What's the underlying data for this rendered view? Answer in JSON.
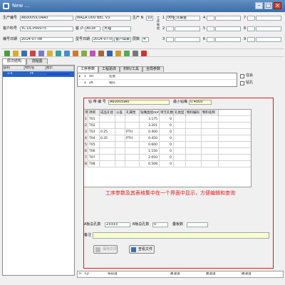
{
  "window": {
    "title": "New ..."
  },
  "header": {
    "prod_no_label": "生产编号",
    "prod_no": "A60005IC04A0",
    "machine": "MAZA D00 BEC V3",
    "prod_qty_label": "生产 N",
    "prod_qty": "10",
    "cust_no_label": "客户料号",
    "cust_no": "YC.DL.P00075",
    "cust_label": "客  户",
    "cust_code": "A018",
    "cust_name": "大福",
    "date_label": "编号日期",
    "date": "2014-07-08",
    "type_date_label": "型号日期",
    "type_date": "2014-07-07",
    "type_date_extra": "客户由来",
    "layers_label": "层数",
    "layers": "4",
    "side_label": "工序制程",
    "right_codes": [
      {
        "code": "1",
        "val": "000",
        "name": "沉镍金"
      },
      {
        "code": "2",
        "val": "",
        "name": ""
      },
      {
        "code": "3",
        "val": "",
        "name": ""
      },
      {
        "code": "4",
        "val": "",
        "name": ""
      },
      {
        "code": "5",
        "val": "",
        "name": ""
      },
      {
        "code": "6",
        "val": "",
        "name": ""
      },
      {
        "code": "7",
        "val": "",
        "name": ""
      },
      {
        "code": "8",
        "val": "",
        "name": ""
      },
      {
        "code": "9",
        "val": "",
        "name": ""
      }
    ]
  },
  "left_tabs": [
    "层次结构",
    "流程图"
  ],
  "left_table": {
    "headers": [
      "层码",
      "材料名",
      "图示"
    ],
    "rows": [
      {
        "code": "1-4",
        "material": "PP"
      }
    ]
  },
  "main_tabs": [
    "工序参数",
    "工程更改",
    "材料/工具",
    "全局参数"
  ],
  "steps": [
    {
      "mark": "▸",
      "num": "1",
      "code": "VH",
      "name": "任会"
    },
    {
      "mark": "",
      "num": "2",
      "code": "ZK",
      "name": "钻孔"
    }
  ],
  "steps_side_labels": [
    "任会",
    "钻孔"
  ],
  "form": {
    "drill_no_label": "钻 带 编 号",
    "drill_no": "A60005IA0",
    "min_drill_label": "最小钻嘴",
    "min_drill": "0.4000"
  },
  "grid": {
    "headers": [
      "序",
      "项目",
      "成品孔径",
      "公差",
      "孔属性",
      "钻嘴直径mm",
      "单元孔数",
      "孔类型",
      "物料编码",
      "物料名称"
    ],
    "rows": [
      [
        "1",
        "T01",
        "",
        "",
        "",
        "3.175",
        "0",
        "",
        "",
        ""
      ],
      [
        "2",
        "T02",
        "",
        "",
        "",
        "3.201",
        "0",
        "",
        "",
        ""
      ],
      [
        "3",
        "T03",
        "0.25",
        "",
        "PTH",
        "0.400",
        "0",
        "",
        "",
        ""
      ],
      [
        "4",
        "T04",
        "0.35",
        "",
        "PTH",
        "0.450",
        "0",
        "",
        "",
        ""
      ],
      [
        "5",
        "T05",
        "",
        "",
        "",
        "0.600",
        "0",
        "",
        "",
        ""
      ],
      [
        "6",
        "T06",
        "",
        "",
        "",
        "1.150",
        "0",
        "",
        "",
        ""
      ],
      [
        "7",
        "T07",
        "",
        "",
        "",
        "2.050",
        "0",
        "",
        "",
        ""
      ],
      [
        "8",
        "T08",
        "",
        "",
        "",
        "0.508",
        "0",
        "",
        "",
        ""
      ]
    ]
  },
  "annotation": "工序参数及其表格集中在一个界面中显示，方便编辑和查询",
  "bottom": {
    "a_holes_label": "A板总孔数",
    "a_holes": "23333",
    "b_holes_label": "B板总孔数",
    "b_holes": "0",
    "board_label": "叠板数",
    "board_val": "",
    "remark_label": "备注",
    "save_btn": "保存文件",
    "view_btn": "查看文件"
  },
  "status": [
    {
      "num": "0",
      "code": "CJI",
      "name": "铣前漫"
    },
    {
      "num": "",
      "code": "",
      "name": "路漫漫"
    },
    {
      "num": "",
      "code": "",
      "name": "路漫漫"
    },
    {
      "num": "",
      "code": "",
      "name": "路漫漫"
    }
  ],
  "colors": {
    "annotation_red": "#e01818",
    "accent_blue": "#1c3fd0",
    "selected_row": "#2563c9",
    "form_yellow": "#ffffd0"
  }
}
